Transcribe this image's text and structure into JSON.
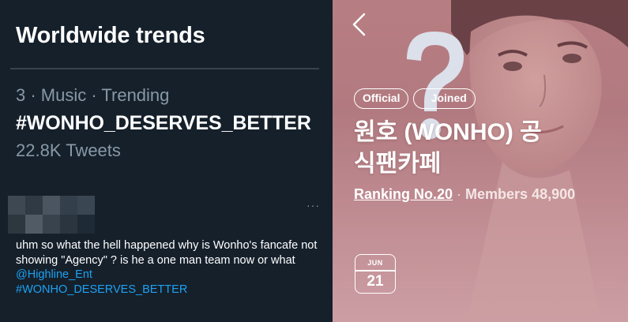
{
  "trends": {
    "title": "Worldwide trends",
    "meta": "3 · Music · Trending",
    "hashtag": "#WONHO_DESERVES_BETTER",
    "count": "22.8K Tweets"
  },
  "tweet": {
    "more_icon": "more-horizontal-icon",
    "more_label": "···",
    "text_1": "uhm so what the hell happened why is Wonho's fancafe not showing \"Agency\" ? is he a one man team now or what ",
    "mention": "@Highline_Ent",
    "hashtag": "#WONHO_DESERVES_BETTER"
  },
  "cafe": {
    "back_icon": "chevron-left-icon",
    "overlay_icon": "question-mark-icon",
    "badges": [
      "Official",
      "Joined"
    ],
    "name_line1": "원호 (WONHO) 공",
    "name_line2": "식팬카페",
    "ranking": "Ranking No.20",
    "separator": " · ",
    "members": "Members 48,900",
    "calendar_month": "JUN",
    "calendar_day": "21"
  },
  "colors": {
    "twitter_bg": "#15202b",
    "twitter_secondary": "#8899a6",
    "twitter_link": "#1da1f2",
    "cafe_tint": "#b98487"
  }
}
